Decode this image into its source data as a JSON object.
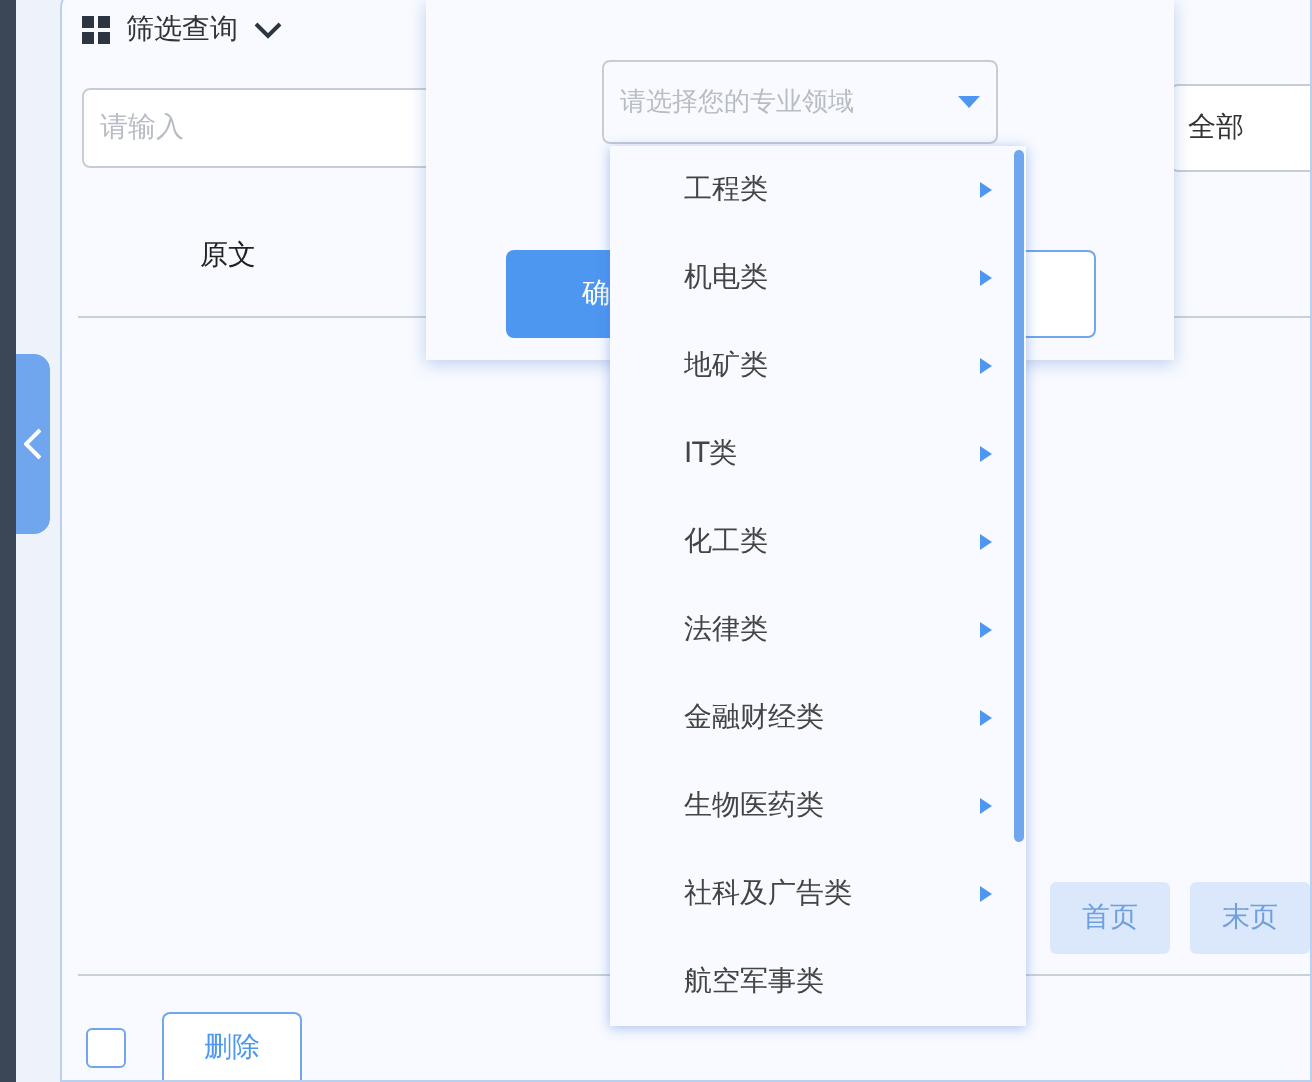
{
  "filter": {
    "title": "筛选查询",
    "keyword": {
      "placeholder": "请输入"
    },
    "scope": {
      "value": "全部"
    }
  },
  "table": {
    "columns": [
      "原文"
    ]
  },
  "pagination": [
    {
      "label": "首页",
      "disabled": true
    },
    {
      "label": "末页",
      "disabled": true
    }
  ],
  "footer": {
    "select_all": {
      "checked": false
    },
    "delete": "删除"
  },
  "popup": {
    "field": {
      "placeholder": "请选择您的专业领域"
    },
    "confirm": "确"
  },
  "domains": [
    {
      "label": "工程类",
      "has_children": true
    },
    {
      "label": "机电类",
      "has_children": true
    },
    {
      "label": "地矿类",
      "has_children": true
    },
    {
      "label": "IT类",
      "has_children": true
    },
    {
      "label": "化工类",
      "has_children": true
    },
    {
      "label": "法律类",
      "has_children": true
    },
    {
      "label": "金融财经类",
      "has_children": true
    },
    {
      "label": "生物医药类",
      "has_children": true
    },
    {
      "label": "社科及广告类",
      "has_children": true
    },
    {
      "label": "航空军事类",
      "has_children": false
    }
  ]
}
